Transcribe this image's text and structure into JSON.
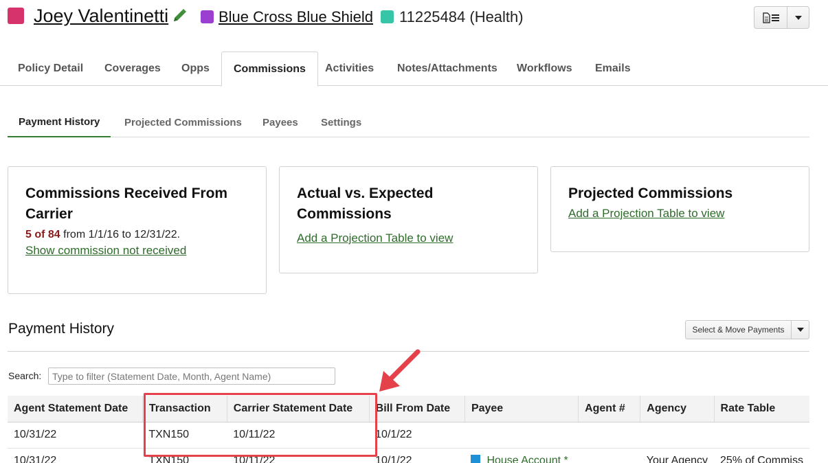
{
  "header": {
    "client_name": "Joey Valentinetti",
    "carrier": "Blue Cross Blue Shield",
    "policy": "11225484 (Health)",
    "colors": {
      "client": "#d6336c",
      "carrier": "#9b3fd1",
      "policy": "#37c5a8"
    },
    "icons": {
      "edit": "pencil-icon",
      "menu": "document-list-icon",
      "dropdown": "caret-down-icon"
    }
  },
  "tabs": [
    {
      "label": "Policy Detail",
      "active": false
    },
    {
      "label": "Coverages",
      "active": false
    },
    {
      "label": "Opps",
      "active": false
    },
    {
      "label": "Commissions",
      "active": true
    },
    {
      "label": "Activities",
      "active": false
    },
    {
      "label": "Notes/Attachments",
      "active": false
    },
    {
      "label": "Workflows",
      "active": false
    },
    {
      "label": "Emails",
      "active": false
    }
  ],
  "subtabs": [
    {
      "label": "Payment History",
      "active": true
    },
    {
      "label": "Projected Commissions",
      "active": false
    },
    {
      "label": "Payees",
      "active": false
    },
    {
      "label": "Settings",
      "active": false
    }
  ],
  "cards": {
    "received": {
      "title": "Commissions Received From Carrier",
      "count": "5 of 84",
      "range": "from 1/1/16 to 12/31/22.",
      "link": "Show commission not received"
    },
    "actual": {
      "title": "Actual vs. Expected Commissions",
      "link": "Add a Projection Table to view"
    },
    "projected": {
      "title": "Projected Commissions",
      "link": "Add a Projection Table to view"
    }
  },
  "payment_history": {
    "title": "Payment History",
    "move_button": "Select & Move Payments",
    "search_label": "Search:",
    "search_placeholder": "Type to filter (Statement Date, Month, Agent Name)",
    "columns": [
      "Agent Statement Date",
      "Transaction",
      "Carrier Statement Date",
      "Bill From Date",
      "Payee",
      "Agent #",
      "Agency",
      "Rate Table"
    ],
    "rows": [
      {
        "agent_statement_date": "10/31/22",
        "transaction": "TXN150",
        "carrier_statement_date": "10/11/22",
        "bill_from_date": "10/1/22",
        "payee": "",
        "agent_no": "",
        "agency": "",
        "rate_table": ""
      },
      {
        "agent_statement_date": "10/31/22",
        "transaction": "TXN150",
        "carrier_statement_date": "10/11/22",
        "bill_from_date": "10/1/22",
        "payee": "House Account *",
        "agent_no": "",
        "agency": "Your Agency",
        "rate_table": "25% of Commiss"
      }
    ]
  }
}
